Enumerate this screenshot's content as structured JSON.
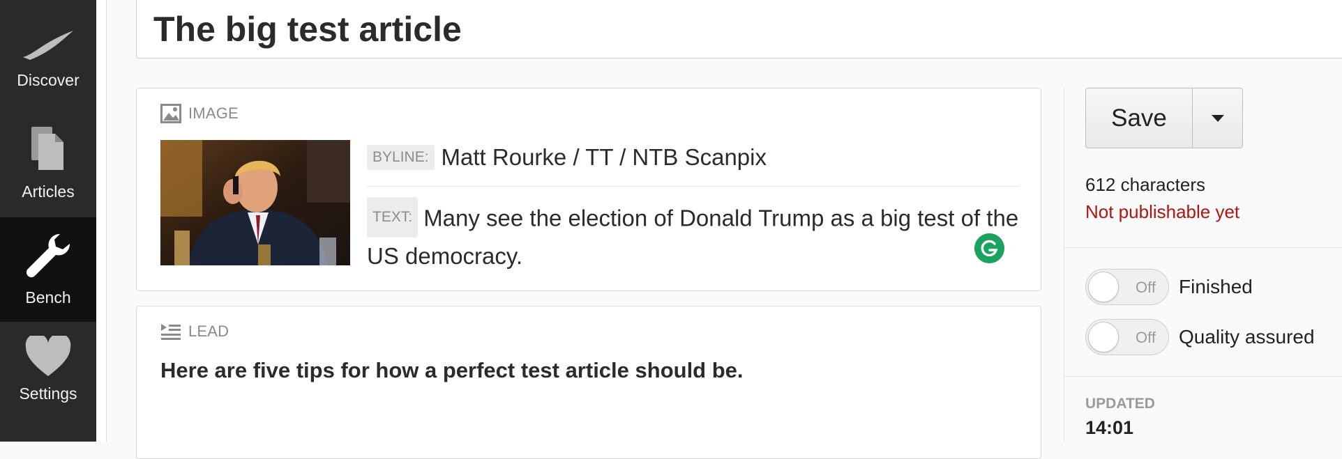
{
  "nav": {
    "items": [
      {
        "label": "Discover",
        "icon": "discover-icon"
      },
      {
        "label": "Articles",
        "icon": "articles-icon"
      },
      {
        "label": "Bench",
        "icon": "wrench-icon",
        "active": true
      },
      {
        "label": "Settings",
        "icon": "heart-icon"
      }
    ]
  },
  "article": {
    "title": "The big test article"
  },
  "image_card": {
    "heading": "IMAGE",
    "byline_tag": "BYLINE:",
    "byline": "Matt Rourke / TT / NTB Scanpix",
    "text_tag": "TEXT:",
    "text": "Many see the election of Donald Trump as a big test of the US democracy."
  },
  "lead_card": {
    "heading": "LEAD",
    "text": "Here are five tips for how a perfect test article should be."
  },
  "sidebar": {
    "save_label": "Save",
    "characters": "612 characters",
    "status": "Not publishable yet",
    "toggles": [
      {
        "state": "Off",
        "label": "Finished"
      },
      {
        "state": "Off",
        "label": "Quality assured"
      }
    ],
    "updated_label": "UPDATED",
    "updated_value": "14:01"
  },
  "colors": {
    "nav_bg": "#2a2a2a",
    "nav_active": "#111111",
    "status_red": "#b0150f",
    "grammarly_green": "#1aa360"
  }
}
